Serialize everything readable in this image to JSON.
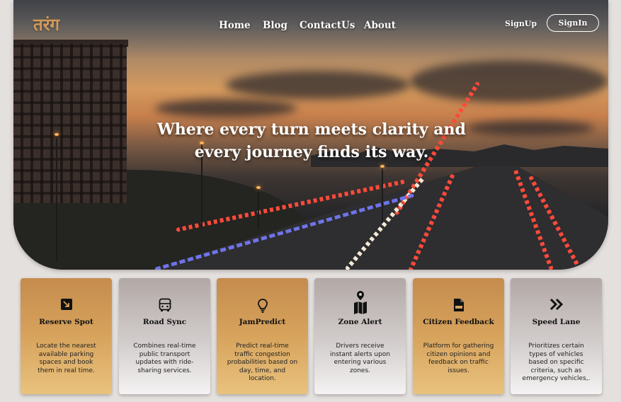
{
  "brand": {
    "logo_text": "तरंग",
    "logo_color": "#d19a5a"
  },
  "nav": {
    "items": [
      {
        "label": "Home"
      },
      {
        "label": "Blog"
      },
      {
        "label": "ContactUs"
      },
      {
        "label": "About"
      }
    ],
    "signup_label": "SignUp",
    "signin_label": "SignIn"
  },
  "hero": {
    "line1": "Where every turn meets clarity and",
    "line2": "every journey finds its way."
  },
  "features": [
    {
      "title": "Reserve Spot",
      "description": "Locate the nearest available parking spaces and book them in real time.",
      "icon": "reserve-square-icon",
      "style": "gold"
    },
    {
      "title": "Road Sync",
      "description": "Combines real-time public transport updates with ride-sharing  services.",
      "icon": "bus-icon",
      "style": "silver"
    },
    {
      "title": "JamPredict",
      "description": "Predict real-time traffic congestion probabilities based on day, time, and location.",
      "icon": "lightbulb-icon",
      "style": "gold"
    },
    {
      "title": "Zone Alert",
      "description": "Drivers receive instant alerts upon entering various zones.",
      "icon": "map-pin-icon",
      "style": "silver"
    },
    {
      "title": "Citizen Feedback",
      "description": "Platform for gathering citizen opinions and feedback on traffic issues.",
      "icon": "document-icon",
      "style": "gold"
    },
    {
      "title": "Speed Lane",
      "description": "Prioritizes certain types of vehicles based on specific criteria, such as emergency vehicles,.",
      "icon": "double-chevron-right-icon",
      "style": "silver"
    }
  ],
  "colors": {
    "gold": "#d7a35c",
    "silver": "#d2cdcc",
    "background": "#e4e0de"
  }
}
